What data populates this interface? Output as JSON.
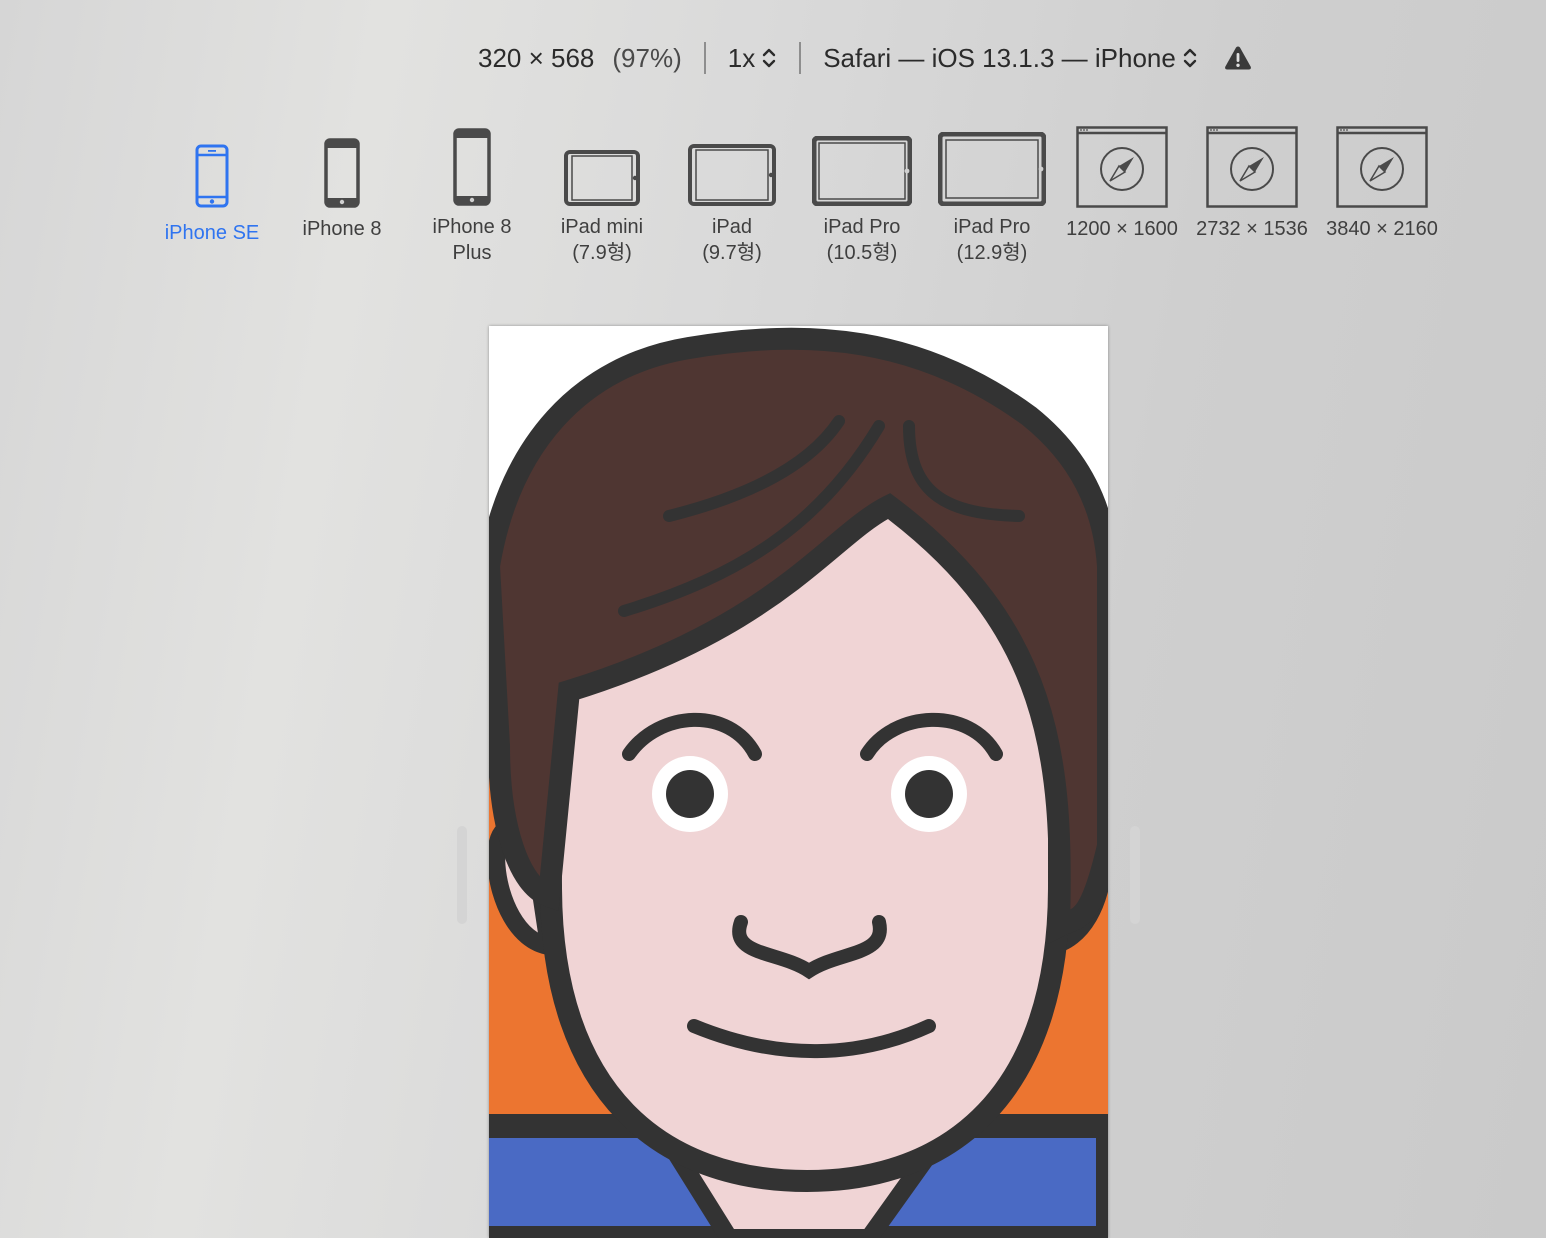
{
  "toolbar": {
    "dimensions": "320 × 568",
    "zoom": "(97%)",
    "scale": "1x",
    "user_agent": "Safari — iOS 13.1.3 — iPhone",
    "warning_icon": "warning-triangle-icon"
  },
  "devices": [
    {
      "label": "iPhone SE",
      "icon": "iphone-icon",
      "active": true
    },
    {
      "label": "iPhone 8",
      "icon": "iphone-icon",
      "active": false
    },
    {
      "label": "iPhone 8\nPlus",
      "icon": "iphone-icon",
      "active": false
    },
    {
      "label": "iPad mini\n(7.9형)",
      "icon": "ipad-icon",
      "active": false
    },
    {
      "label": "iPad\n(9.7형)",
      "icon": "ipad-icon",
      "active": false
    },
    {
      "label": "iPad Pro\n(10.5형)",
      "icon": "ipad-icon",
      "active": false
    },
    {
      "label": "iPad Pro\n(12.9형)",
      "icon": "ipad-icon",
      "active": false
    },
    {
      "label": "1200 × 1600",
      "icon": "safari-window-icon",
      "active": false
    },
    {
      "label": "2732 × 1536",
      "icon": "safari-window-icon",
      "active": false
    },
    {
      "label": "3840 × 2160",
      "icon": "safari-window-icon",
      "active": false
    }
  ],
  "colors": {
    "accent": "#2f74f0",
    "hair": "#4f3632",
    "skin": "#f0d4d5",
    "outline": "#333333",
    "background_orange": "#ec7530",
    "shirt_blue": "#4a6ac4"
  }
}
